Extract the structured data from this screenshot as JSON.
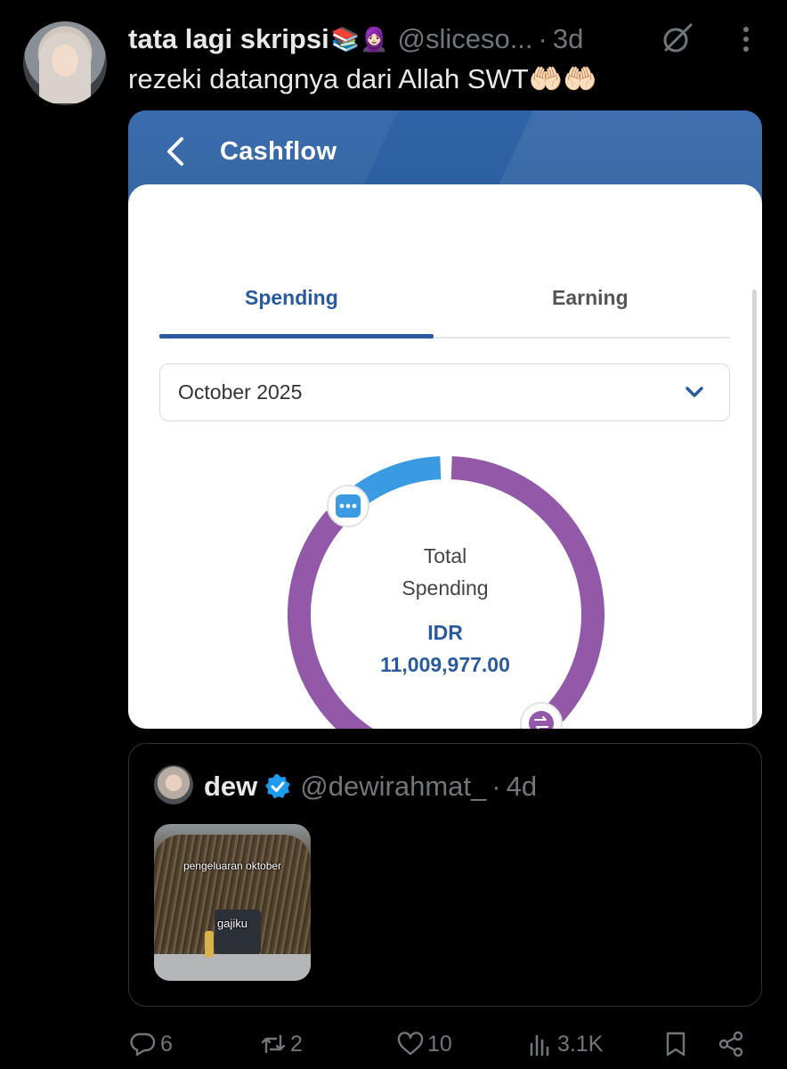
{
  "tweet": {
    "author_name": "tata lagi skripsi",
    "author_emoji": "📚🧕🏻",
    "handle": "@sliceso...",
    "separator": "·",
    "time": "3d",
    "text": "rezeki datangnya dari Allah SWT🤲🏻🤲🏻"
  },
  "cashflow": {
    "title": "Cashflow",
    "tabs": [
      {
        "label": "Spending",
        "active": true
      },
      {
        "label": "Earning",
        "active": false
      }
    ],
    "month": "October 2025",
    "total_label_line1": "Total",
    "total_label_line2": "Spending",
    "currency": "IDR",
    "amount": "11,009,977.00",
    "segments": [
      {
        "name": "other",
        "fraction": 0.13,
        "color": "#3a9be3"
      },
      {
        "name": "transfer",
        "fraction": 0.87,
        "color": "#9159a8"
      }
    ]
  },
  "quote": {
    "author_name": "dew",
    "handle": "@dewirahmat_",
    "separator": "·",
    "time": "4d",
    "meme_top": "pengeluaran oktober",
    "meme_bottom": "gajiku"
  },
  "actions": {
    "replies": "6",
    "reposts": "2",
    "likes": "10",
    "views": "3.1K"
  },
  "colors": {
    "background": "#000000",
    "brand_blue": "#2a5a9e",
    "muted": "#71767b",
    "verified": "#1d9bf0"
  }
}
